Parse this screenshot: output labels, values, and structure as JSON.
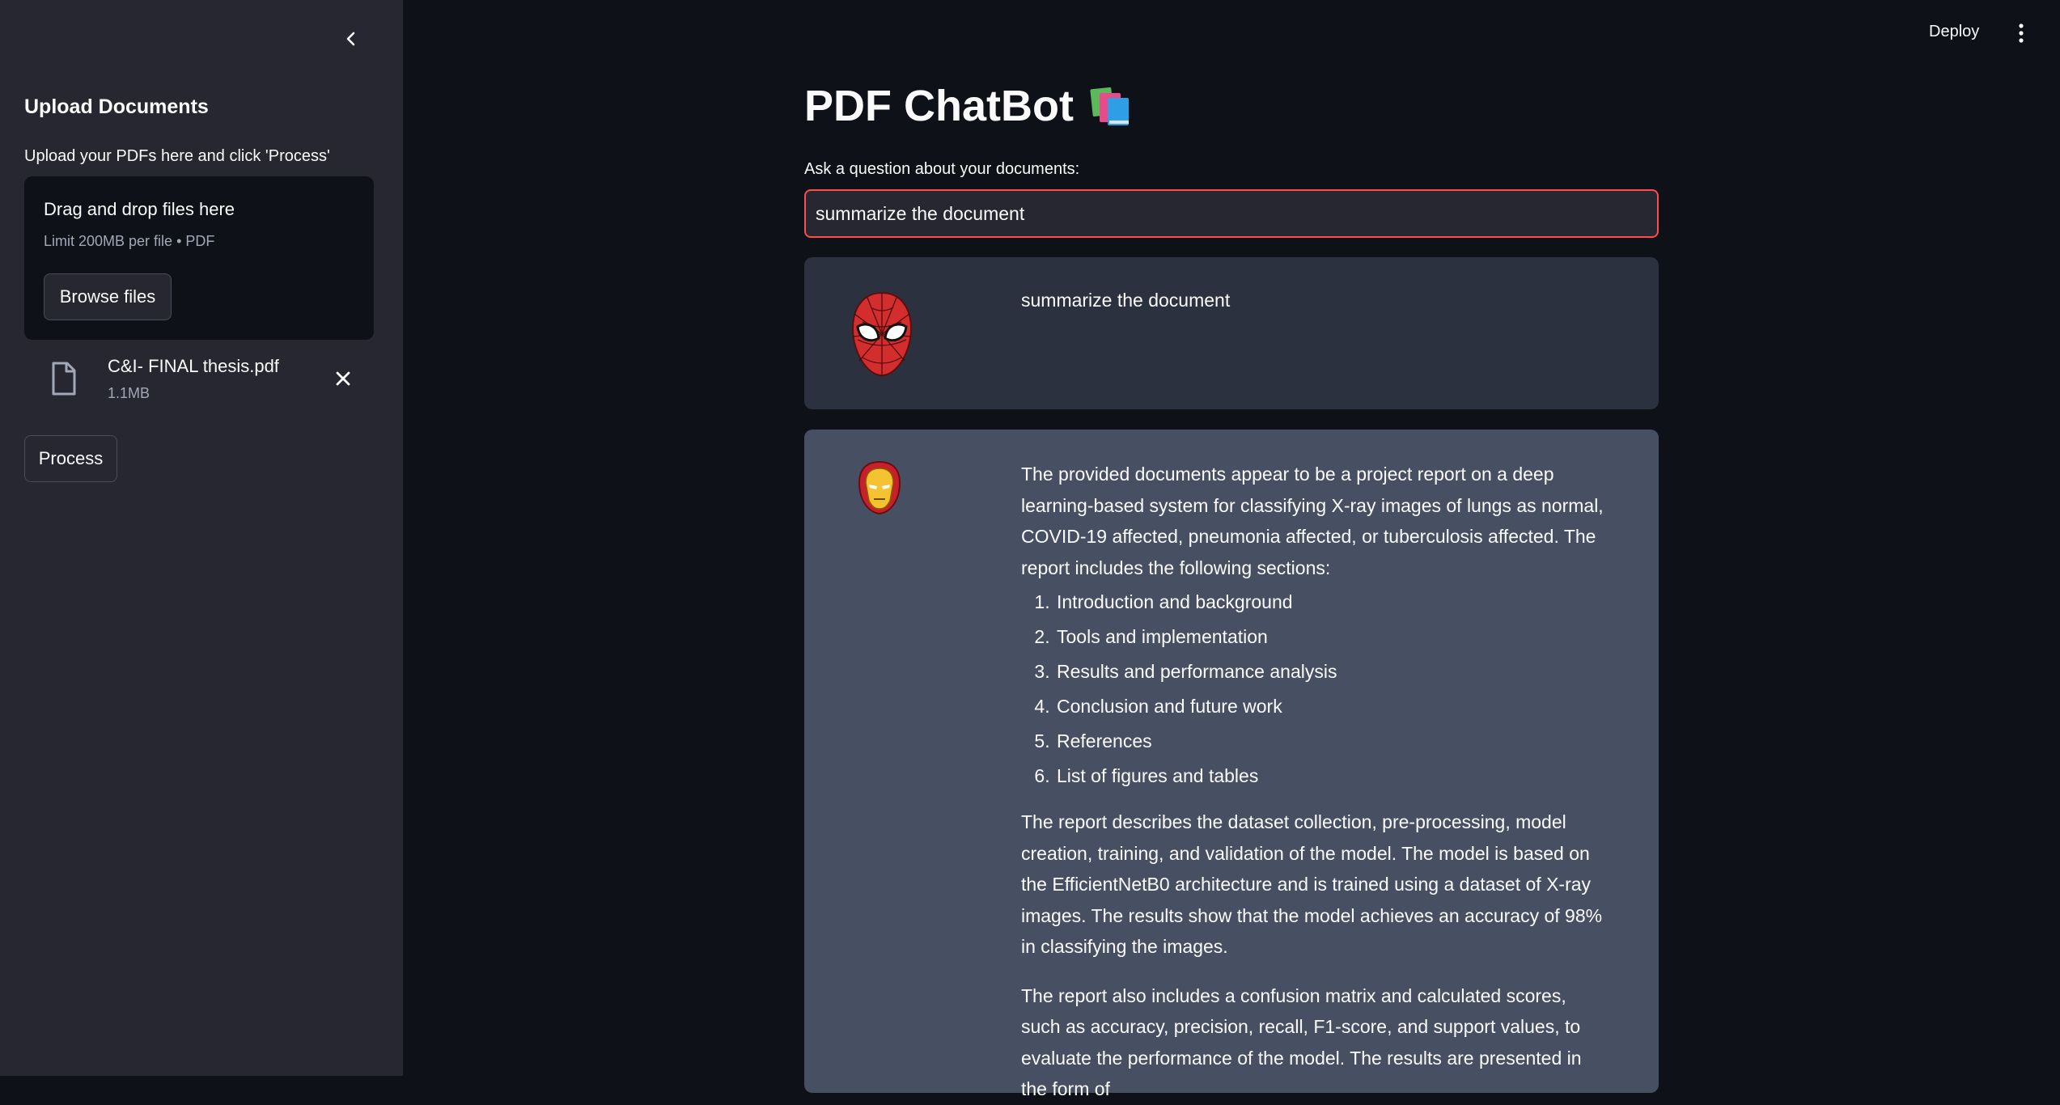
{
  "sidebar": {
    "title": "Upload Documents",
    "subtitle": "Upload your PDFs here and click 'Process'",
    "dropzone": {
      "title": "Drag and drop files here",
      "limit": "Limit 200MB per file • PDF",
      "browse_label": "Browse files"
    },
    "file": {
      "name": "C&I- FINAL thesis.pdf",
      "size": "1.1MB"
    },
    "process_label": "Process"
  },
  "header": {
    "deploy_label": "Deploy"
  },
  "main": {
    "title": "PDF ChatBot",
    "question_label": "Ask a question about your documents:",
    "question_value": "summarize the document",
    "messages": {
      "user": "summarize the document",
      "bot": {
        "intro": "The provided documents appear to be a project report on a deep learning-based system for classifying X-ray images of lungs as normal, COVID-19 affected, pneumonia affected, or tuberculosis affected. The report includes the following sections:",
        "sections": [
          "Introduction and background",
          "Tools and implementation",
          "Results and performance analysis",
          "Conclusion and future work",
          "References",
          "List of figures and tables"
        ],
        "para2": "The report describes the dataset collection, pre-processing, model creation, training, and validation of the model. The model is based on the EfficientNetB0 architecture and is trained using a dataset of X-ray images. The results show that the model achieves an accuracy of 98% in classifying the images.",
        "para3": "The report also includes a confusion matrix and calculated scores, such as accuracy, precision, recall, F1-score, and support values, to evaluate the performance of the model. The results are presented in the form of"
      }
    }
  },
  "colors": {
    "app_bg": "#0e1117",
    "sidebar_bg": "#262730",
    "user_msg_bg": "#2b313e",
    "bot_msg_bg": "#475063",
    "input_focus_border": "#ff4b4b"
  },
  "icons": {
    "collapse": "chevron-left-icon",
    "file": "file-icon",
    "remove": "close-icon",
    "menu": "more-vertical-icon",
    "title": "books-icon",
    "user_avatar": "spiderman-avatar",
    "bot_avatar": "ironman-avatar"
  }
}
